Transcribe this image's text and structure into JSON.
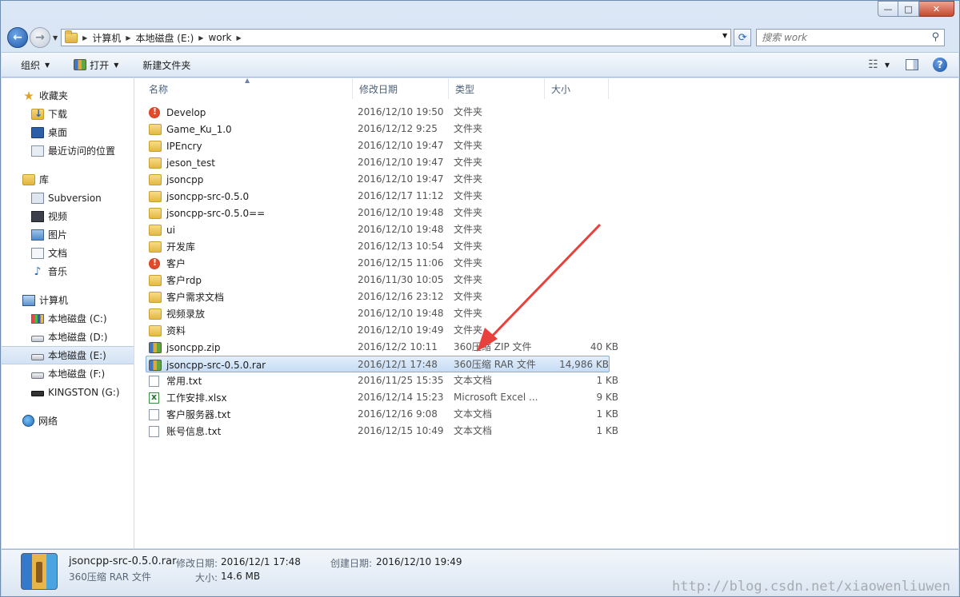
{
  "window": {
    "minimize_glyph": "—",
    "maximize_glyph": "□",
    "close_glyph": "✕"
  },
  "address": {
    "segments": [
      "计算机",
      "本地磁盘 (E:)",
      "work"
    ],
    "search_placeholder": "搜索 work"
  },
  "toolbar": {
    "organize_label": "组织",
    "open_label": "打开",
    "new_folder_label": "新建文件夹"
  },
  "nav": {
    "favorites": "收藏夹",
    "downloads": "下载",
    "desktop": "桌面",
    "recent": "最近访问的位置",
    "libraries": "库",
    "subversion": "Subversion",
    "videos": "视频",
    "pictures": "图片",
    "documents": "文档",
    "music": "音乐",
    "computer": "计算机",
    "drive_c": "本地磁盘 (C:)",
    "drive_d": "本地磁盘 (D:)",
    "drive_e": "本地磁盘 (E:)",
    "drive_f": "本地磁盘 (F:)",
    "drive_g": "KINGSTON (G:)",
    "network": "网络"
  },
  "columns": {
    "name": "名称",
    "date": "修改日期",
    "type": "类型",
    "size": "大小"
  },
  "files": [
    {
      "name": "Develop",
      "date": "2016/12/10 19:50",
      "type": "文件夹",
      "size": "",
      "icon": "folder-error-icon"
    },
    {
      "name": "Game_Ku_1.0",
      "date": "2016/12/12 9:25",
      "type": "文件夹",
      "size": "",
      "icon": "folder-icon"
    },
    {
      "name": "IPEncry",
      "date": "2016/12/10 19:47",
      "type": "文件夹",
      "size": "",
      "icon": "folder-icon"
    },
    {
      "name": "jeson_test",
      "date": "2016/12/10 19:47",
      "type": "文件夹",
      "size": "",
      "icon": "folder-icon"
    },
    {
      "name": "jsoncpp",
      "date": "2016/12/10 19:47",
      "type": "文件夹",
      "size": "",
      "icon": "folder-icon"
    },
    {
      "name": "jsoncpp-src-0.5.0",
      "date": "2016/12/17 11:12",
      "type": "文件夹",
      "size": "",
      "icon": "folder-icon"
    },
    {
      "name": "jsoncpp-src-0.5.0==",
      "date": "2016/12/10 19:48",
      "type": "文件夹",
      "size": "",
      "icon": "folder-icon"
    },
    {
      "name": "ui",
      "date": "2016/12/10 19:48",
      "type": "文件夹",
      "size": "",
      "icon": "folder-icon"
    },
    {
      "name": "开发库",
      "date": "2016/12/13 10:54",
      "type": "文件夹",
      "size": "",
      "icon": "folder-icon"
    },
    {
      "name": "客户",
      "date": "2016/12/15 11:06",
      "type": "文件夹",
      "size": "",
      "icon": "folder-error-icon"
    },
    {
      "name": "客户rdp",
      "date": "2016/11/30 10:05",
      "type": "文件夹",
      "size": "",
      "icon": "folder-icon"
    },
    {
      "name": "客户需求文档",
      "date": "2016/12/16 23:12",
      "type": "文件夹",
      "size": "",
      "icon": "folder-icon"
    },
    {
      "name": "视频录放",
      "date": "2016/12/10 19:48",
      "type": "文件夹",
      "size": "",
      "icon": "folder-icon"
    },
    {
      "name": "资料",
      "date": "2016/12/10 19:49",
      "type": "文件夹",
      "size": "",
      "icon": "folder-icon"
    },
    {
      "name": "jsoncpp.zip",
      "date": "2016/12/2 10:11",
      "type": "360压缩 ZIP 文件",
      "size": "40 KB",
      "icon": "archive-icon"
    },
    {
      "name": "jsoncpp-src-0.5.0.rar",
      "date": "2016/12/1 17:48",
      "type": "360压缩 RAR 文件",
      "size": "14,986 KB",
      "icon": "archive-icon"
    },
    {
      "name": "常用.txt",
      "date": "2016/11/25 15:35",
      "type": "文本文档",
      "size": "1 KB",
      "icon": "text-file-icon"
    },
    {
      "name": "工作安排.xlsx",
      "date": "2016/12/14 15:23",
      "type": "Microsoft Excel ...",
      "size": "9 KB",
      "icon": "excel-file-icon"
    },
    {
      "name": "客户服务器.txt",
      "date": "2016/12/16 9:08",
      "type": "文本文档",
      "size": "1 KB",
      "icon": "text-file-icon"
    },
    {
      "name": "账号信息.txt",
      "date": "2016/12/15 10:49",
      "type": "文本文档",
      "size": "1 KB",
      "icon": "text-file-icon"
    }
  ],
  "selected_index": 15,
  "details": {
    "filename": "jsoncpp-src-0.5.0.rar",
    "filetype": "360压缩 RAR 文件",
    "modified_label": "修改日期:",
    "modified_value": "2016/12/1 17:48",
    "size_label": "大小:",
    "size_value": "14.6 MB",
    "created_label": "创建日期:",
    "created_value": "2016/12/10 19:49"
  },
  "watermark": "http://blog.csdn.net/xiaowenliuwen",
  "colors": {
    "annotation_arrow": "#e8413c",
    "selection": "#cce0f7"
  }
}
